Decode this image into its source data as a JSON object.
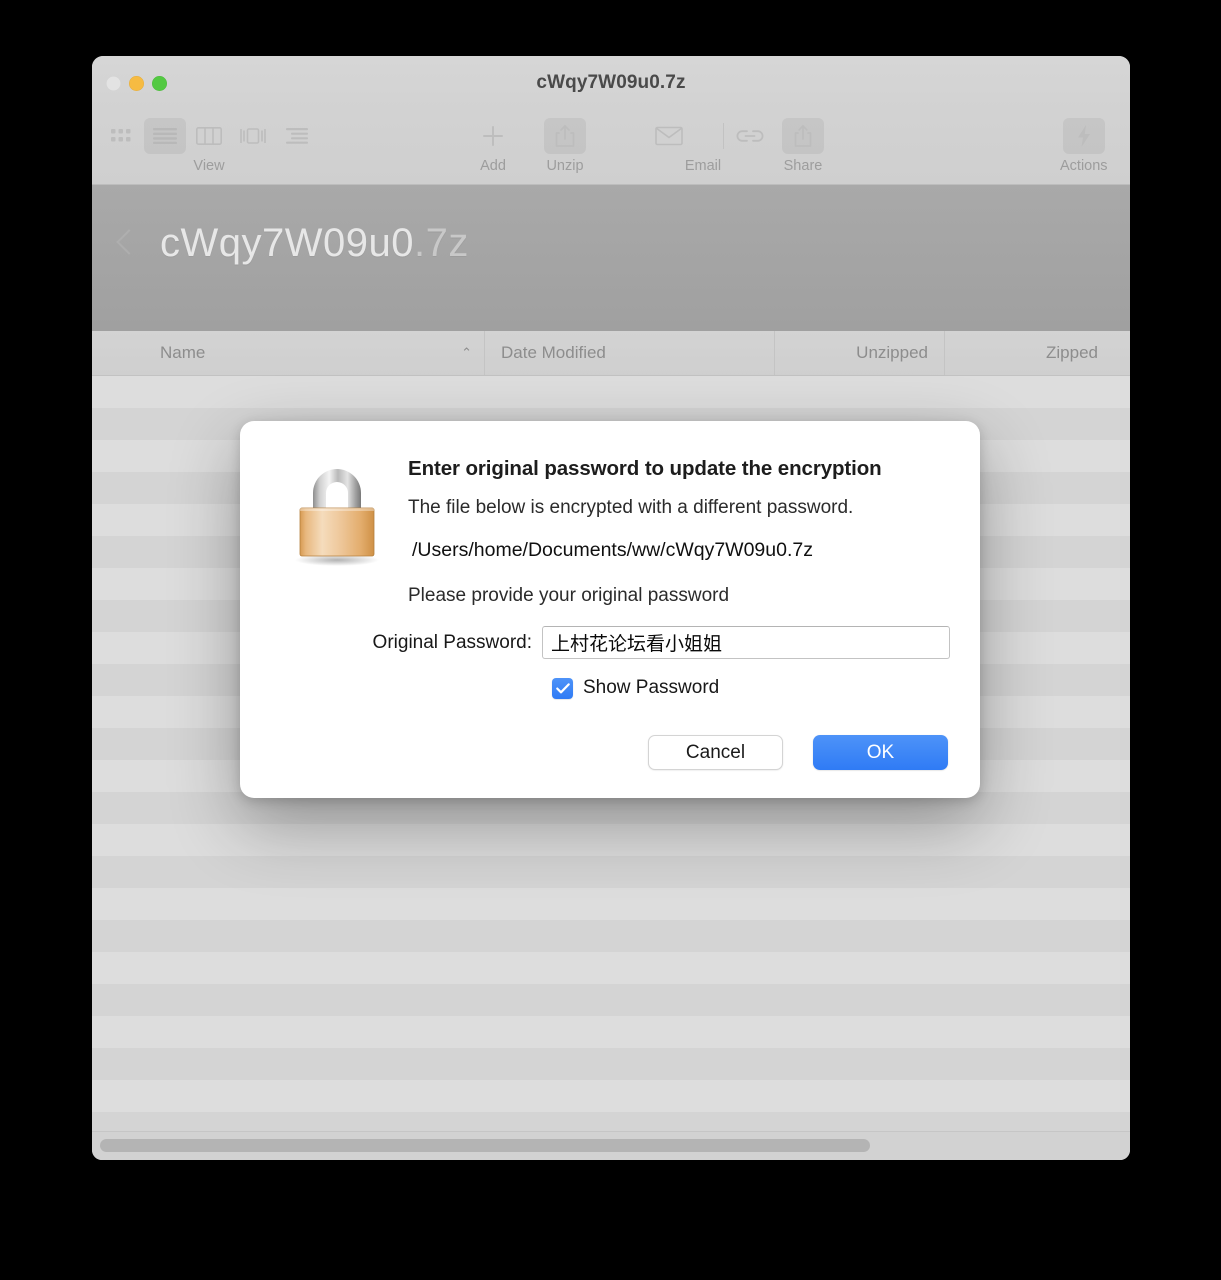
{
  "window": {
    "title": "cWqy7W09u0.7z",
    "traffic_lights": [
      {
        "name": "close",
        "color": "#e3e3e3"
      },
      {
        "name": "minimize",
        "color": "#f6bb42"
      },
      {
        "name": "maximize",
        "color": "#53c942"
      }
    ]
  },
  "toolbar": {
    "groups": [
      {
        "label": "View",
        "icons": [
          "icon-grid-icon",
          "list-view-icon",
          "column-view-icon",
          "gallery-view-icon",
          "outline-view-icon"
        ]
      },
      {
        "label": "Add",
        "icons": [
          "plus-icon"
        ]
      },
      {
        "label": "Unzip",
        "icons": [
          "unzip-icon"
        ]
      },
      {
        "label": "Email",
        "icons": [
          "envelope-icon"
        ]
      },
      {
        "label": "",
        "icons": [
          "link-chain-icon"
        ]
      },
      {
        "label": "Share",
        "icons": [
          "share-icon"
        ]
      },
      {
        "label": "Actions",
        "icons": [
          "lightning-bolt-icon"
        ]
      }
    ]
  },
  "hero": {
    "filename_base": "cWqy7W09u0",
    "filename_ext": ".7z"
  },
  "file_list": {
    "columns": [
      {
        "label": "Name",
        "sort": "ascending"
      },
      {
        "label": "Date Modified",
        "sort": ""
      },
      {
        "label": "Unzipped",
        "sort": ""
      },
      {
        "label": "Zipped",
        "sort": ""
      }
    ],
    "sort_caret": "⌃",
    "rows": []
  },
  "dialog": {
    "icon": "padlock-icon",
    "heading": "Enter original password to update the encryption",
    "subtitle": "The file below is encrypted with a different password.",
    "file_path": "/Users/home/Documents/ww/cWqy7W09u0.7z",
    "prompt": "Please provide your original password",
    "password_label": "Original Password:",
    "password_value": "上村花论坛看小姐姐",
    "password_placeholder": "",
    "show_password_label": "Show Password",
    "show_password_checked": true,
    "cancel_label": "Cancel",
    "ok_label": "OK"
  },
  "colors": {
    "accent_blue": "#2f7bf5",
    "window_chrome": "#d2d2d2",
    "hero_banner": "#a4a4a4",
    "list_stripe_light": "#dddddd",
    "list_stripe_dark": "#d4d4d4"
  }
}
